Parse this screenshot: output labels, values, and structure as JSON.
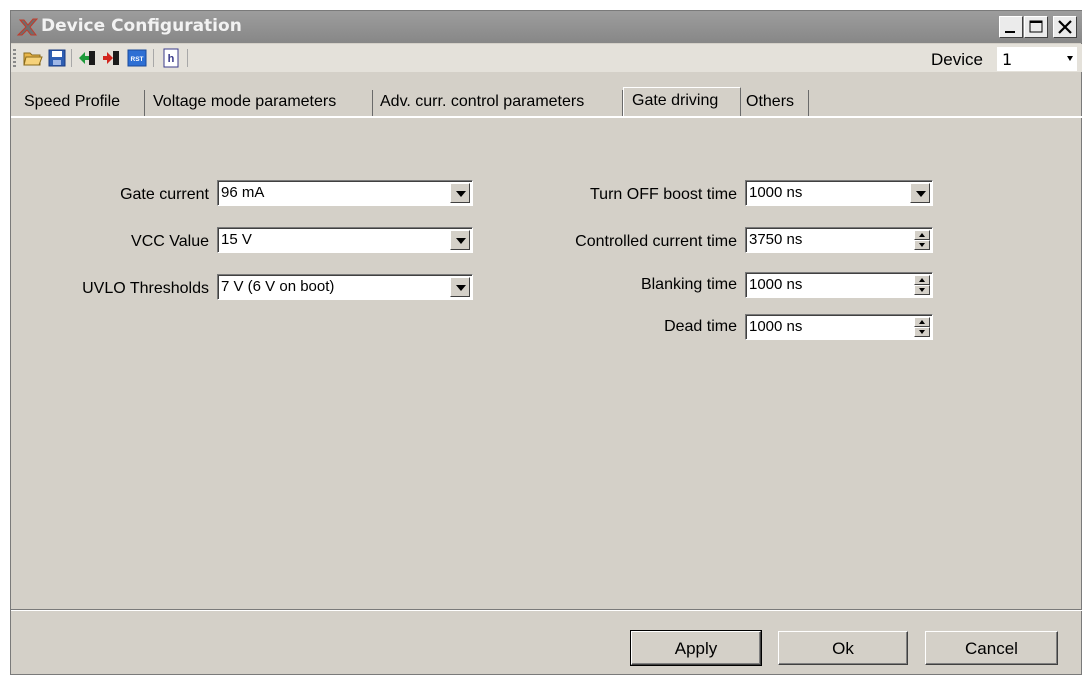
{
  "window": {
    "title": "Device Configuration"
  },
  "title_buttons": {
    "minimize": "minimize",
    "maximize": "maximize",
    "close": "close"
  },
  "toolbar": {
    "icons": [
      "open-folder-icon",
      "save-icon",
      "import-green-icon",
      "export-red-icon",
      "rst-icon",
      "help-icon"
    ],
    "rst_label": "RST",
    "help_label": "h",
    "device_label": "Device",
    "device_value": "1"
  },
  "tabs": [
    {
      "label": "Speed Profile",
      "active": false
    },
    {
      "label": "Voltage mode parameters",
      "active": false
    },
    {
      "label": "Adv. curr. control parameters",
      "active": false
    },
    {
      "label": "Gate driving",
      "active": true
    },
    {
      "label": "Others",
      "active": false
    }
  ],
  "left_fields": [
    {
      "label": "Gate current",
      "value": "96 mA"
    },
    {
      "label": "VCC Value",
      "value": "15 V"
    },
    {
      "label": "UVLO Thresholds",
      "value": "7 V (6 V on boot)"
    }
  ],
  "right_fields": [
    {
      "label": "Turn OFF boost time",
      "value": "1000 ns",
      "kind": "dropdown"
    },
    {
      "label": "Controlled current time",
      "value": "3750 ns",
      "kind": "spinner"
    },
    {
      "label": "Blanking time",
      "value": "1000 ns",
      "kind": "spinner"
    },
    {
      "label": "Dead time",
      "value": "1000 ns",
      "kind": "spinner"
    }
  ],
  "buttons": {
    "apply": "Apply",
    "ok": "Ok",
    "cancel": "Cancel"
  }
}
